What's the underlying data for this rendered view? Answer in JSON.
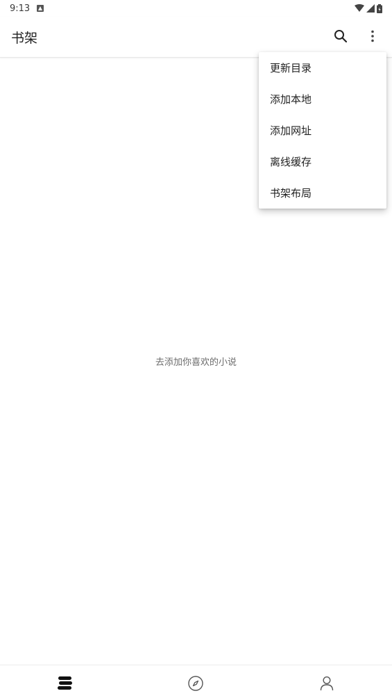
{
  "status_bar": {
    "time": "9:13",
    "notification_icon": "a-notification-icon",
    "wifi_icon": "wifi-icon",
    "signal_icon": "signal-icon",
    "battery_icon": "battery-icon"
  },
  "app_bar": {
    "title": "书架",
    "search_icon": "search-icon",
    "more_icon": "more-vertical-icon"
  },
  "menu": {
    "items": [
      {
        "label": "更新目录"
      },
      {
        "label": "添加本地"
      },
      {
        "label": "添加网址"
      },
      {
        "label": "离线缓存"
      },
      {
        "label": "书架布局"
      }
    ]
  },
  "main": {
    "empty_message": "去添加你喜欢的小说"
  },
  "bottom_nav": {
    "items": [
      {
        "icon": "bookshelf-icon",
        "active": true
      },
      {
        "icon": "compass-icon",
        "active": false
      },
      {
        "icon": "person-icon",
        "active": false
      }
    ]
  },
  "colors": {
    "text_primary": "#222222",
    "text_secondary": "#6d6d6d",
    "background": "#ffffff",
    "divider": "#e6e6e6"
  }
}
